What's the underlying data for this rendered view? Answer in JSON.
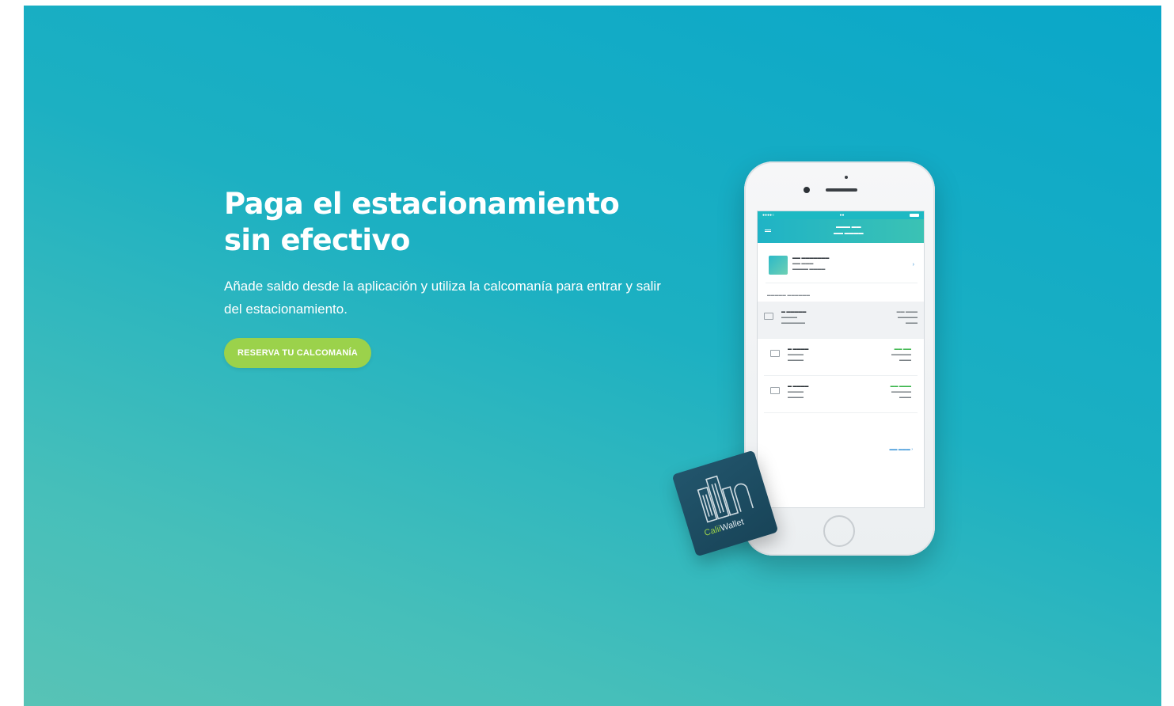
{
  "hero": {
    "title_line1": "Paga el estacionamiento",
    "title_line2": "sin efectivo",
    "subtitle": "Añade saldo desde la aplicación y utiliza la calcomanía para entrar y salir del estacionamiento.",
    "cta_label": "RESERVA TU CALCOMANÍA"
  },
  "sticker": {
    "brand_prefix": "Calii",
    "brand_suffix": "Wallet"
  },
  "colors": {
    "gradient_top": "#0aa7c9",
    "gradient_bottom": "#58c3b6",
    "cta": "#9bd24b"
  }
}
